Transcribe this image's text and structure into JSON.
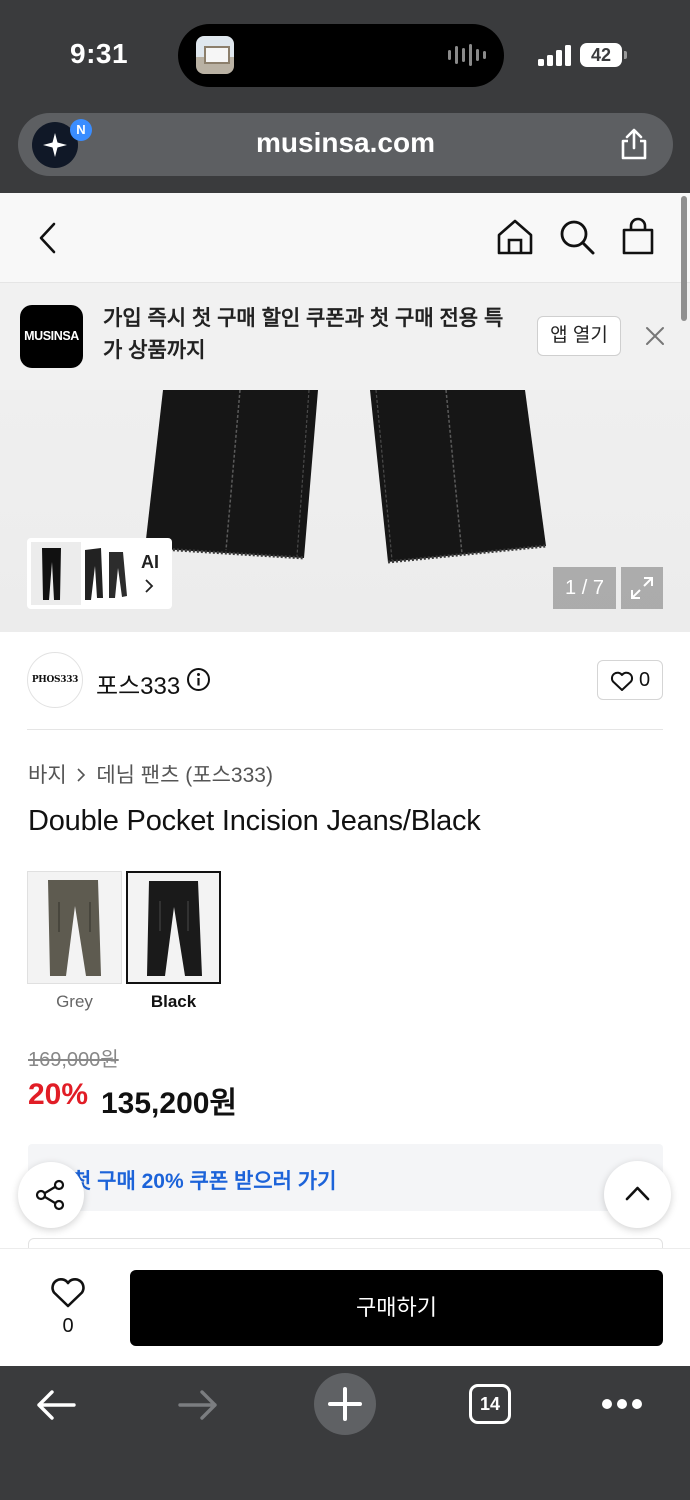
{
  "status_bar": {
    "time": "9:31",
    "battery": "42"
  },
  "browser": {
    "url": "musinsa.com",
    "ai_badge": "N",
    "tabs_count": "14"
  },
  "app_banner": {
    "logo_text": "MUSINSA",
    "message": "가입 즉시 첫 구매 할인 쿠폰과 첫 구매 전용 특가 상품까지",
    "open_app_label": "앱 열기"
  },
  "gallery": {
    "ai_label": "AI",
    "page_counter": "1 / 7"
  },
  "brand": {
    "logo_text": "PHOS333",
    "name": "포스333",
    "like_count": "0"
  },
  "product": {
    "breadcrumb": [
      "바지",
      "데님 팬츠 (포스333)"
    ],
    "title": "Double Pocket Incision Jeans/Black",
    "variants": [
      {
        "label": "Grey",
        "color": "#5e5b50",
        "selected": false
      },
      {
        "label": "Black",
        "color": "#1a1a1a",
        "selected": true
      }
    ],
    "price_original": "169,000원",
    "discount_rate": "20%",
    "price_final": "135,200원",
    "coupon_text": "첫 구매 20% 쿠폰 받으러 가기"
  },
  "purchase_bar": {
    "wish_count": "0",
    "buy_label": "구매하기"
  },
  "colors": {
    "brand_black": "#000000",
    "discount_red": "#e11d26",
    "coupon_blue": "#1c63d9",
    "chrome_gray": "#3a3b3d"
  }
}
